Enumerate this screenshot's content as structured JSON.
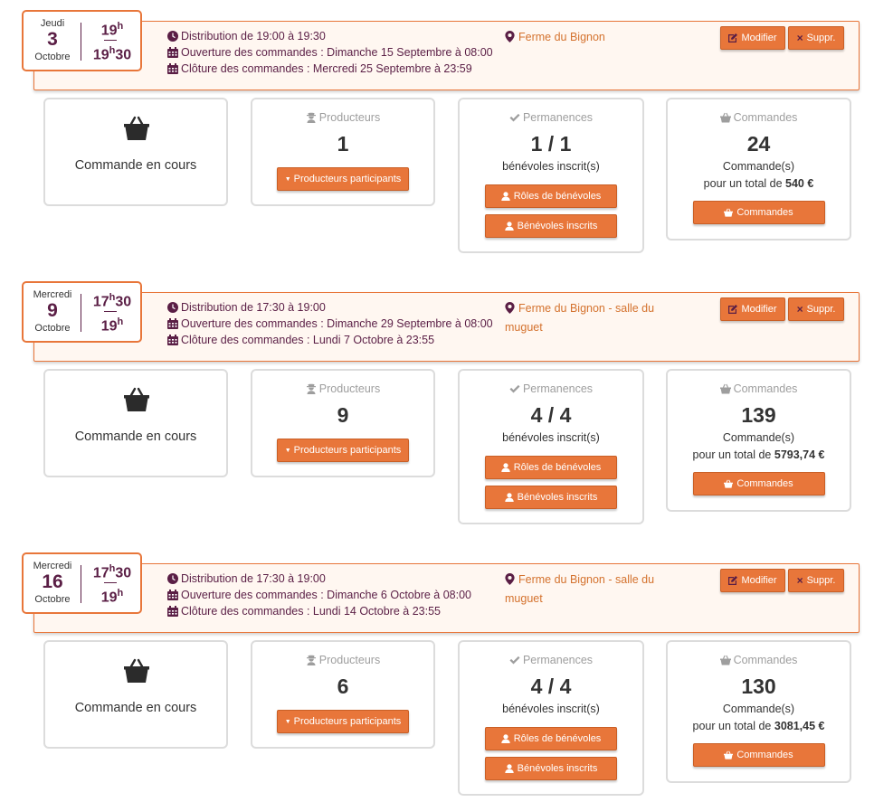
{
  "distributions": [
    {
      "date": {
        "weekday": "Jeudi",
        "day": "3",
        "month": "Octobre",
        "start": "19",
        "end": "19",
        "end_min": "30",
        "start_min": ""
      },
      "schedule": "Distribution de 19:00 à 19:30",
      "opening": "Ouverture des commandes : Dimanche 15 Septembre à 08:00",
      "closing": "Clôture des commandes : Mercredi 25 Septembre à 23:59",
      "place": "Ferme du Bignon",
      "modify_label": "Modifier",
      "delete_label": "Suppr.",
      "status_label": "Commande en cours",
      "producers": {
        "title": "Producteurs",
        "count": "1",
        "button": "Producteurs participants"
      },
      "shifts": {
        "title": "Permanences",
        "count": "1 / 1",
        "sub": "bénévoles inscrit(s)",
        "roles_button": "Rôles de bénévoles",
        "volunteers_button": "Bénévoles inscrits"
      },
      "orders": {
        "title": "Commandes",
        "count": "24",
        "sub": "Commande(s)",
        "total_prefix": "pour un total de",
        "total": "540 €",
        "button": "Commandes"
      }
    },
    {
      "date": {
        "weekday": "Mercredi",
        "day": "9",
        "month": "Octobre",
        "start": "17",
        "start_min": "30",
        "end": "19",
        "end_min": ""
      },
      "schedule": "Distribution de 17:30 à 19:00",
      "opening": "Ouverture des commandes : Dimanche 29 Septembre à 08:00",
      "closing": "Clôture des commandes : Lundi 7 Octobre à 23:55",
      "place": "Ferme du Bignon - salle du muguet",
      "modify_label": "Modifier",
      "delete_label": "Suppr.",
      "status_label": "Commande en cours",
      "producers": {
        "title": "Producteurs",
        "count": "9",
        "button": "Producteurs participants"
      },
      "shifts": {
        "title": "Permanences",
        "count": "4 / 4",
        "sub": "bénévoles inscrit(s)",
        "roles_button": "Rôles de bénévoles",
        "volunteers_button": "Bénévoles inscrits"
      },
      "orders": {
        "title": "Commandes",
        "count": "139",
        "sub": "Commande(s)",
        "total_prefix": "pour un total de",
        "total": "5793,74 €",
        "button": "Commandes"
      }
    },
    {
      "date": {
        "weekday": "Mercredi",
        "day": "16",
        "month": "Octobre",
        "start": "17",
        "start_min": "30",
        "end": "19",
        "end_min": ""
      },
      "schedule": "Distribution de 17:30 à 19:00",
      "opening": "Ouverture des commandes : Dimanche 6 Octobre à 08:00",
      "closing": "Clôture des commandes : Lundi 14 Octobre à 23:55",
      "place": "Ferme du Bignon - salle du muguet",
      "modify_label": "Modifier",
      "delete_label": "Suppr.",
      "status_label": "Commande en cours",
      "producers": {
        "title": "Producteurs",
        "count": "6",
        "button": "Producteurs participants"
      },
      "shifts": {
        "title": "Permanences",
        "count": "4 / 4",
        "sub": "bénévoles inscrit(s)",
        "roles_button": "Rôles de bénévoles",
        "volunteers_button": "Bénévoles inscrits"
      },
      "orders": {
        "title": "Commandes",
        "count": "130",
        "sub": "Commande(s)",
        "total_prefix": "pour un total de",
        "total": "3081,45 €",
        "button": "Commandes"
      }
    }
  ],
  "hour_suffix": "h",
  "colors": {
    "accent": "#e8763a",
    "brand": "#5a1e45",
    "header_bg": "#fff7f1"
  },
  "icons": {
    "schedule": "clock-icon",
    "calendar": "calendar-icon",
    "place": "map-marker-icon",
    "modify": "edit-icon",
    "delete": "close-icon",
    "basket": "basket-icon",
    "producer": "farmer-icon",
    "shifts": "check-icon",
    "user": "user-icon",
    "caret": "caret-down-icon"
  }
}
